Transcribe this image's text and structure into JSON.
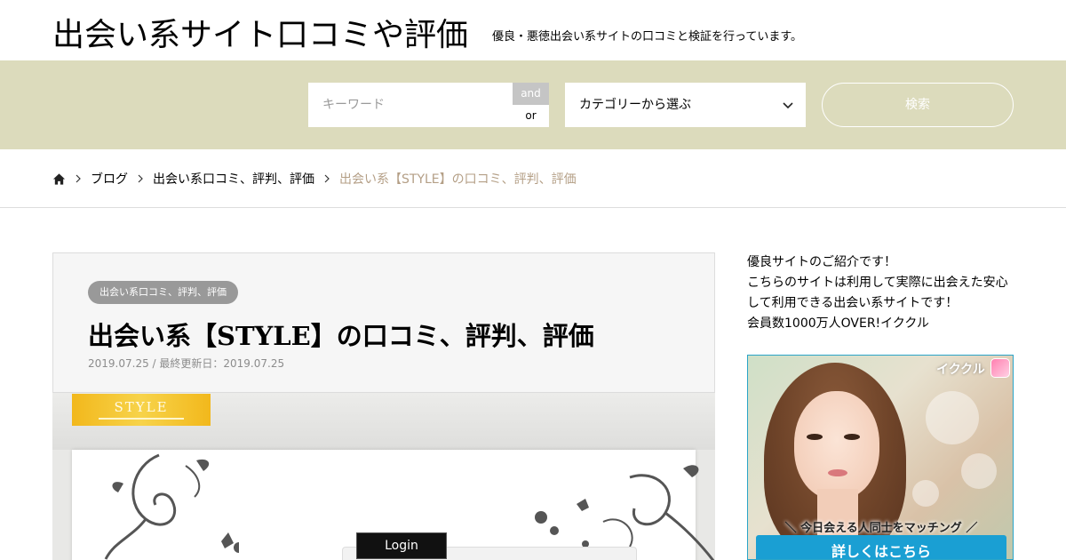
{
  "header": {
    "site_title": "出会い系サイト口コミや評価",
    "site_description": "優良・悪徳出会い系サイトの口コミと検証を行っています。"
  },
  "search": {
    "keyword_placeholder": "キーワード",
    "keyword_value": "",
    "mode_and": "and",
    "mode_or": "or",
    "mode_selected": "and",
    "category_selected": "カテゴリーから選ぶ",
    "submit_label": "検索",
    "band_color": "#dcdbbc"
  },
  "breadcrumb": {
    "items": [
      "ブログ",
      "出会い系口コミ、評判、評価"
    ],
    "current": "出会い系【STYLE】の口コミ、評判、評価",
    "current_color": "#b49f86"
  },
  "article": {
    "category_badge": "出会い系口コミ、評判、評価",
    "title": "出会い系【STYLE】の口コミ、評判、評価",
    "date_line": "2019.07.25 / 最終更新日：2019.07.25",
    "featured_image": {
      "logo_text": "STYLE",
      "login_label": "Login"
    }
  },
  "sidebar": {
    "intro_lines": [
      "優良サイトのご紹介です！",
      "こちらのサイトは利用して実際に出会えた安心して利用できる出会い系サイトです！",
      "会員数1000万人OVER!イククル"
    ],
    "banner": {
      "brand": "イククル",
      "tagline": "＼ 今日会える人同士をマッチング ／",
      "cta_label": "詳しくはこちら",
      "cta_color": "#1a9fd3"
    }
  }
}
